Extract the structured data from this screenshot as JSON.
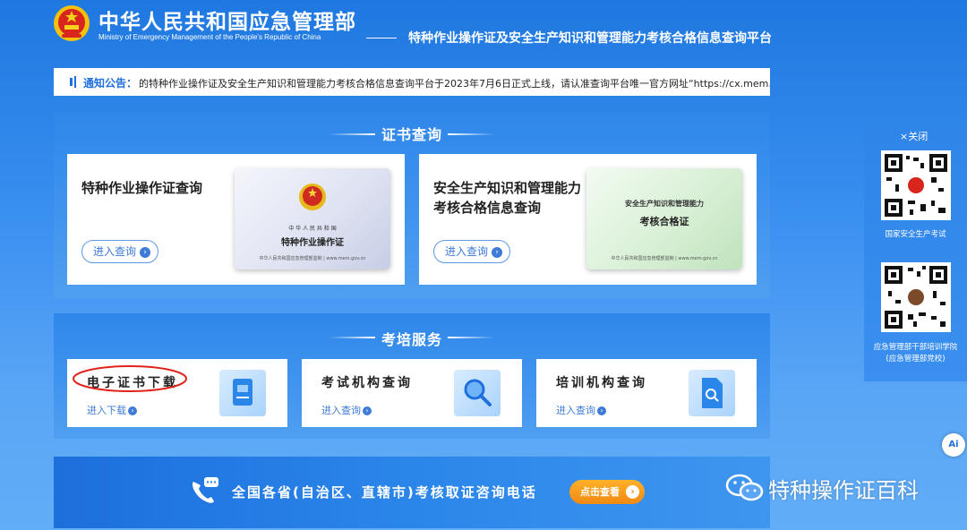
{
  "header": {
    "title": "中华人民共和国应急管理部",
    "subtitle": "Ministry of Emergency Management of the People's Republic of China",
    "platform": "特种作业操作证及安全生产知识和管理能力考核合格信息查询平台"
  },
  "notice": {
    "label": "通知公告：",
    "text": "的特种作业操作证及安全生产知识和管理能力考核合格信息查询平台于2023年7月6日正式上线，请认准查询平台唯一官方网址“https://cx.mem."
  },
  "cert_section": {
    "title": "证书查询",
    "cards": [
      {
        "title": "特种作业操作证查询",
        "link": "进入查询",
        "image": {
          "line1": "中 华 人 民 共 和 国",
          "line2": "特种作业操作证",
          "footer": "中华人民共和国应急管理部监制 | www.mem.gov.cn"
        }
      },
      {
        "title_line1": "安全生产知识和管理能力",
        "title_line2": "考核合格信息查询",
        "link": "进入查询",
        "image": {
          "line1": "安全生产知识和管理能力",
          "line2": "考核合格证",
          "footer": "中华人民共和国应急管理部监制 | www.mem.gov.cn"
        }
      }
    ]
  },
  "train_section": {
    "title": "考培服务",
    "cards": [
      {
        "title": "电子证书下载",
        "link": "进入下载",
        "icon": "certificate-icon"
      },
      {
        "title": "考试机构查询",
        "link": "进入查询",
        "icon": "magnifier-icon"
      },
      {
        "title": "培训机构查询",
        "link": "进入查询",
        "icon": "document-search-icon"
      }
    ]
  },
  "hotline": {
    "text": "全国各省(自治区、直辖市)考核取证咨询电话",
    "button": "点击查看",
    "icon": "phone-chat-icon"
  },
  "side_panel": {
    "close": "×关闭",
    "qr1_caption": "国家安全生产考试",
    "qr2_caption_line1": "应急管理部干部培训学院",
    "qr2_caption_line2": "(应急管理部党校)"
  },
  "ai_button": "Ai",
  "watermark": "特种操作证百科",
  "colors": {
    "accent": "#1f6fe0",
    "highlight_circle": "#e0241d",
    "hotline_button": "#f08a12"
  }
}
